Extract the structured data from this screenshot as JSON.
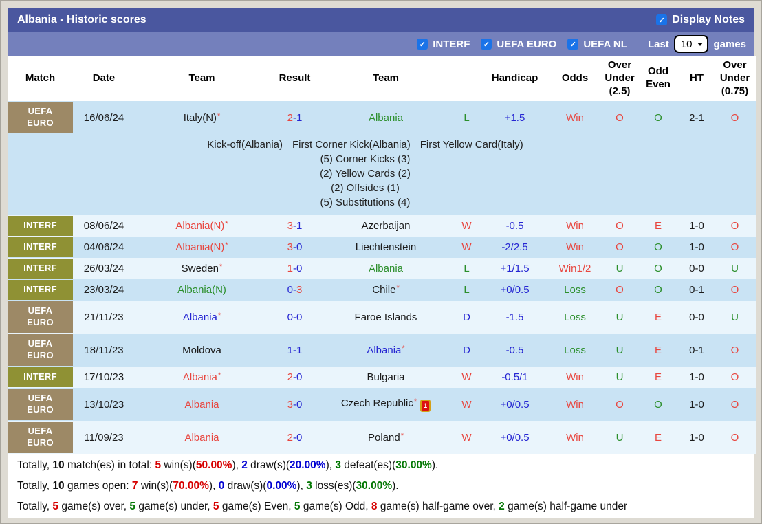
{
  "colors": {
    "red": "#e8463f",
    "blue": "#2525d2",
    "green": "#2c8f2c",
    "black": "#1c1c1c",
    "sred": "#d60000",
    "sblue": "#0000d2",
    "sgreen": "#057805",
    "badge_euro": "#9d8966",
    "badge_interf": "#8f9134",
    "shade_dark": "#c9e3f4",
    "shade_light": "#eaf5fc",
    "title_bar_bg": "#4a579f",
    "filter_bar_bg": "#7480bc",
    "checkbox_blue": "#1a73e8"
  },
  "title_bar": {
    "title": "Albania - Historic scores",
    "display_notes_label": "Display Notes",
    "display_notes_checked": true
  },
  "filter_bar": {
    "checkboxes": [
      {
        "label": "INTERF",
        "checked": true
      },
      {
        "label": "UEFA EURO",
        "checked": true
      },
      {
        "label": "UEFA NL",
        "checked": true
      }
    ],
    "last_label": "Last",
    "games_count": "10",
    "games_label": "games"
  },
  "table": {
    "headers": [
      "Match",
      "Date",
      "Team",
      "Result",
      "Team",
      "",
      "Handicap",
      "Odds",
      "Over Under (2.5)",
      "Odd Even",
      "HT",
      "Over Under (0.75)"
    ],
    "rows": [
      {
        "badge": [
          "UEFA",
          "EURO"
        ],
        "badge_color": "euro",
        "shade": "dark",
        "date": "16/06/24",
        "home": {
          "name": "Italy(N)",
          "color": "black",
          "star": "*"
        },
        "result": {
          "h": "2",
          "sep": "-",
          "a": "1",
          "hc": "red",
          "ac": "blue"
        },
        "away": {
          "name": "Albania",
          "color": "green"
        },
        "wld": {
          "t": "L",
          "c": "green"
        },
        "hcap": "+1.5",
        "odds": {
          "t": "Win",
          "c": "red"
        },
        "ou25": {
          "t": "O",
          "c": "red"
        },
        "oe": {
          "t": "O",
          "c": "green"
        },
        "ht": "2-1",
        "ou075": {
          "t": "O",
          "c": "red"
        },
        "notes": {
          "events": [
            "Kick-off(Albania)",
            "First Corner Kick(Albania)",
            "First Yellow Card(Italy)"
          ],
          "stats": [
            "(5) Corner Kicks (3)",
            "(2) Yellow Cards (2)",
            "(2) Offsides (1)",
            "(5) Substitutions (4)"
          ]
        }
      },
      {
        "badge": [
          "INTERF"
        ],
        "badge_color": "interf",
        "shade": "light",
        "date": "08/06/24",
        "home": {
          "name": "Albania(N)",
          "color": "red",
          "star": "*"
        },
        "result": {
          "h": "3",
          "sep": "-",
          "a": "1",
          "hc": "red",
          "ac": "blue"
        },
        "away": {
          "name": "Azerbaijan",
          "color": "black"
        },
        "wld": {
          "t": "W",
          "c": "red"
        },
        "hcap": "-0.5",
        "odds": {
          "t": "Win",
          "c": "red"
        },
        "ou25": {
          "t": "O",
          "c": "red"
        },
        "oe": {
          "t": "E",
          "c": "red"
        },
        "ht": "1-0",
        "ou075": {
          "t": "O",
          "c": "red"
        }
      },
      {
        "badge": [
          "INTERF"
        ],
        "badge_color": "interf",
        "shade": "dark",
        "date": "04/06/24",
        "home": {
          "name": "Albania(N)",
          "color": "red",
          "star": "*"
        },
        "result": {
          "h": "3",
          "sep": "-",
          "a": "0",
          "hc": "red",
          "ac": "blue"
        },
        "away": {
          "name": "Liechtenstein",
          "color": "black"
        },
        "wld": {
          "t": "W",
          "c": "red"
        },
        "hcap": "-2/2.5",
        "odds": {
          "t": "Win",
          "c": "red"
        },
        "ou25": {
          "t": "O",
          "c": "red"
        },
        "oe": {
          "t": "O",
          "c": "green"
        },
        "ht": "1-0",
        "ou075": {
          "t": "O",
          "c": "red"
        }
      },
      {
        "badge": [
          "INTERF"
        ],
        "badge_color": "interf",
        "shade": "light",
        "date": "26/03/24",
        "home": {
          "name": "Sweden",
          "color": "black",
          "star": "*"
        },
        "result": {
          "h": "1",
          "sep": "-",
          "a": "0",
          "hc": "red",
          "ac": "blue"
        },
        "away": {
          "name": "Albania",
          "color": "green"
        },
        "wld": {
          "t": "L",
          "c": "green"
        },
        "hcap": "+1/1.5",
        "odds": {
          "t": "Win1/2",
          "c": "red"
        },
        "ou25": {
          "t": "U",
          "c": "green"
        },
        "oe": {
          "t": "O",
          "c": "green"
        },
        "ht": "0-0",
        "ou075": {
          "t": "U",
          "c": "green"
        }
      },
      {
        "badge": [
          "INTERF"
        ],
        "badge_color": "interf",
        "shade": "dark",
        "date": "23/03/24",
        "home": {
          "name": "Albania(N)",
          "color": "green"
        },
        "result": {
          "h": "0",
          "sep": "-",
          "a": "3",
          "hc": "blue",
          "ac": "red"
        },
        "away": {
          "name": "Chile",
          "color": "black",
          "star": "*"
        },
        "wld": {
          "t": "L",
          "c": "green"
        },
        "hcap": "+0/0.5",
        "odds": {
          "t": "Loss",
          "c": "green"
        },
        "ou25": {
          "t": "O",
          "c": "red"
        },
        "oe": {
          "t": "O",
          "c": "green"
        },
        "ht": "0-1",
        "ou075": {
          "t": "O",
          "c": "red"
        }
      },
      {
        "badge": [
          "UEFA",
          "EURO"
        ],
        "badge_color": "euro",
        "shade": "light",
        "date": "21/11/23",
        "home": {
          "name": "Albania",
          "color": "blue",
          "star": "*"
        },
        "result": {
          "h": "0",
          "sep": "-",
          "a": "0",
          "hc": "blue",
          "ac": "blue"
        },
        "away": {
          "name": "Faroe Islands",
          "color": "black"
        },
        "wld": {
          "t": "D",
          "c": "blue"
        },
        "hcap": "-1.5",
        "odds": {
          "t": "Loss",
          "c": "green"
        },
        "ou25": {
          "t": "U",
          "c": "green"
        },
        "oe": {
          "t": "E",
          "c": "red"
        },
        "ht": "0-0",
        "ou075": {
          "t": "U",
          "c": "green"
        }
      },
      {
        "badge": [
          "UEFA",
          "EURO"
        ],
        "badge_color": "euro",
        "shade": "dark",
        "date": "18/11/23",
        "home": {
          "name": "Moldova",
          "color": "black"
        },
        "result": {
          "h": "1",
          "sep": "-",
          "a": "1",
          "hc": "blue",
          "ac": "blue"
        },
        "away": {
          "name": "Albania",
          "color": "blue",
          "star": "*"
        },
        "wld": {
          "t": "D",
          "c": "blue"
        },
        "hcap": "-0.5",
        "odds": {
          "t": "Loss",
          "c": "green"
        },
        "ou25": {
          "t": "U",
          "c": "green"
        },
        "oe": {
          "t": "E",
          "c": "red"
        },
        "ht": "0-1",
        "ou075": {
          "t": "O",
          "c": "red"
        }
      },
      {
        "badge": [
          "INTERF"
        ],
        "badge_color": "interf",
        "shade": "light",
        "date": "17/10/23",
        "home": {
          "name": "Albania",
          "color": "red",
          "star": "*"
        },
        "result": {
          "h": "2",
          "sep": "-",
          "a": "0",
          "hc": "red",
          "ac": "blue"
        },
        "away": {
          "name": "Bulgaria",
          "color": "black"
        },
        "wld": {
          "t": "W",
          "c": "red"
        },
        "hcap": "-0.5/1",
        "odds": {
          "t": "Win",
          "c": "red"
        },
        "ou25": {
          "t": "U",
          "c": "green"
        },
        "oe": {
          "t": "E",
          "c": "red"
        },
        "ht": "1-0",
        "ou075": {
          "t": "O",
          "c": "red"
        }
      },
      {
        "badge": [
          "UEFA",
          "EURO"
        ],
        "badge_color": "euro",
        "shade": "dark",
        "date": "13/10/23",
        "home": {
          "name": "Albania",
          "color": "red"
        },
        "result": {
          "h": "3",
          "sep": "-",
          "a": "0",
          "hc": "red",
          "ac": "blue"
        },
        "away": {
          "name": "Czech Republic",
          "color": "black",
          "star": "*",
          "red_card": "1"
        },
        "wld": {
          "t": "W",
          "c": "red"
        },
        "hcap": "+0/0.5",
        "odds": {
          "t": "Win",
          "c": "red"
        },
        "ou25": {
          "t": "O",
          "c": "red"
        },
        "oe": {
          "t": "O",
          "c": "green"
        },
        "ht": "1-0",
        "ou075": {
          "t": "O",
          "c": "red"
        }
      },
      {
        "badge": [
          "UEFA",
          "EURO"
        ],
        "badge_color": "euro",
        "shade": "light",
        "date": "11/09/23",
        "home": {
          "name": "Albania",
          "color": "red"
        },
        "result": {
          "h": "2",
          "sep": "-",
          "a": "0",
          "hc": "red",
          "ac": "blue"
        },
        "away": {
          "name": "Poland",
          "color": "black",
          "star": "*"
        },
        "wld": {
          "t": "W",
          "c": "red"
        },
        "hcap": "+0/0.5",
        "odds": {
          "t": "Win",
          "c": "red"
        },
        "ou25": {
          "t": "U",
          "c": "green"
        },
        "oe": {
          "t": "E",
          "c": "red"
        },
        "ht": "1-0",
        "ou075": {
          "t": "O",
          "c": "red"
        }
      }
    ]
  },
  "summary": {
    "lines": [
      [
        {
          "t": "Totally, "
        },
        {
          "t": "10",
          "b": 1
        },
        {
          "t": " match(es) in total: "
        },
        {
          "t": "5",
          "b": 1,
          "c": "sred"
        },
        {
          "t": " win(s)("
        },
        {
          "t": "50.00%",
          "b": 1,
          "c": "sred"
        },
        {
          "t": "), "
        },
        {
          "t": "2",
          "b": 1,
          "c": "sblue"
        },
        {
          "t": " draw(s)("
        },
        {
          "t": "20.00%",
          "b": 1,
          "c": "sblue"
        },
        {
          "t": "), "
        },
        {
          "t": "3",
          "b": 1,
          "c": "sgreen"
        },
        {
          "t": " defeat(es)("
        },
        {
          "t": "30.00%",
          "b": 1,
          "c": "sgreen"
        },
        {
          "t": ")."
        }
      ],
      [
        {
          "t": "Totally, "
        },
        {
          "t": "10",
          "b": 1
        },
        {
          "t": " games open: "
        },
        {
          "t": "7",
          "b": 1,
          "c": "sred"
        },
        {
          "t": " win(s)("
        },
        {
          "t": "70.00%",
          "b": 1,
          "c": "sred"
        },
        {
          "t": "), "
        },
        {
          "t": "0",
          "b": 1,
          "c": "sblue"
        },
        {
          "t": " draw(s)("
        },
        {
          "t": "0.00%",
          "b": 1,
          "c": "sblue"
        },
        {
          "t": "), "
        },
        {
          "t": "3",
          "b": 1,
          "c": "sgreen"
        },
        {
          "t": " loss(es)("
        },
        {
          "t": "30.00%",
          "b": 1,
          "c": "sgreen"
        },
        {
          "t": ")."
        }
      ],
      [
        {
          "t": "Totally, "
        },
        {
          "t": "5",
          "b": 1,
          "c": "sred"
        },
        {
          "t": " game(s) over, "
        },
        {
          "t": "5",
          "b": 1,
          "c": "sgreen"
        },
        {
          "t": " game(s) under, "
        },
        {
          "t": "5",
          "b": 1,
          "c": "sred"
        },
        {
          "t": " game(s) Even, "
        },
        {
          "t": "5",
          "b": 1,
          "c": "sgreen"
        },
        {
          "t": " game(s) Odd, "
        },
        {
          "t": "8",
          "b": 1,
          "c": "sred"
        },
        {
          "t": " game(s) half-game over, "
        },
        {
          "t": "2",
          "b": 1,
          "c": "sgreen"
        },
        {
          "t": " game(s) half-game under"
        }
      ]
    ]
  }
}
